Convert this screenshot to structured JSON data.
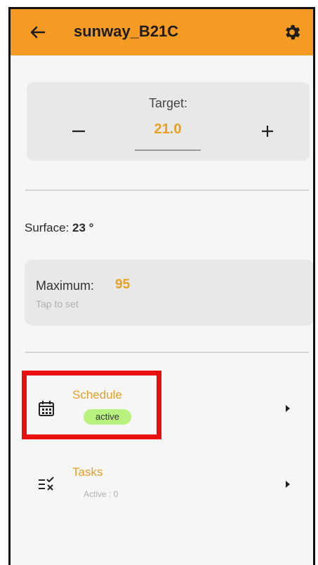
{
  "header": {
    "title": "sunway_B21C",
    "back_icon": "arrow-left-icon",
    "settings_icon": "gear-icon"
  },
  "target": {
    "label": "Target:",
    "value": "21.0"
  },
  "surface": {
    "label": "Surface:",
    "value": "23 °"
  },
  "maximum": {
    "label": "Maximum:",
    "value": "95",
    "hint": "Tap to set"
  },
  "menu": {
    "schedule": {
      "label": "Schedule",
      "badge": "active",
      "icon": "calendar-icon"
    },
    "tasks": {
      "label": "Tasks",
      "subtitle": "Active : 0",
      "icon": "task-list-icon"
    }
  },
  "colors": {
    "header": "#f59a23",
    "accent": "#e99f22",
    "badge": "#b7f27e",
    "highlight": "#ea1010"
  }
}
